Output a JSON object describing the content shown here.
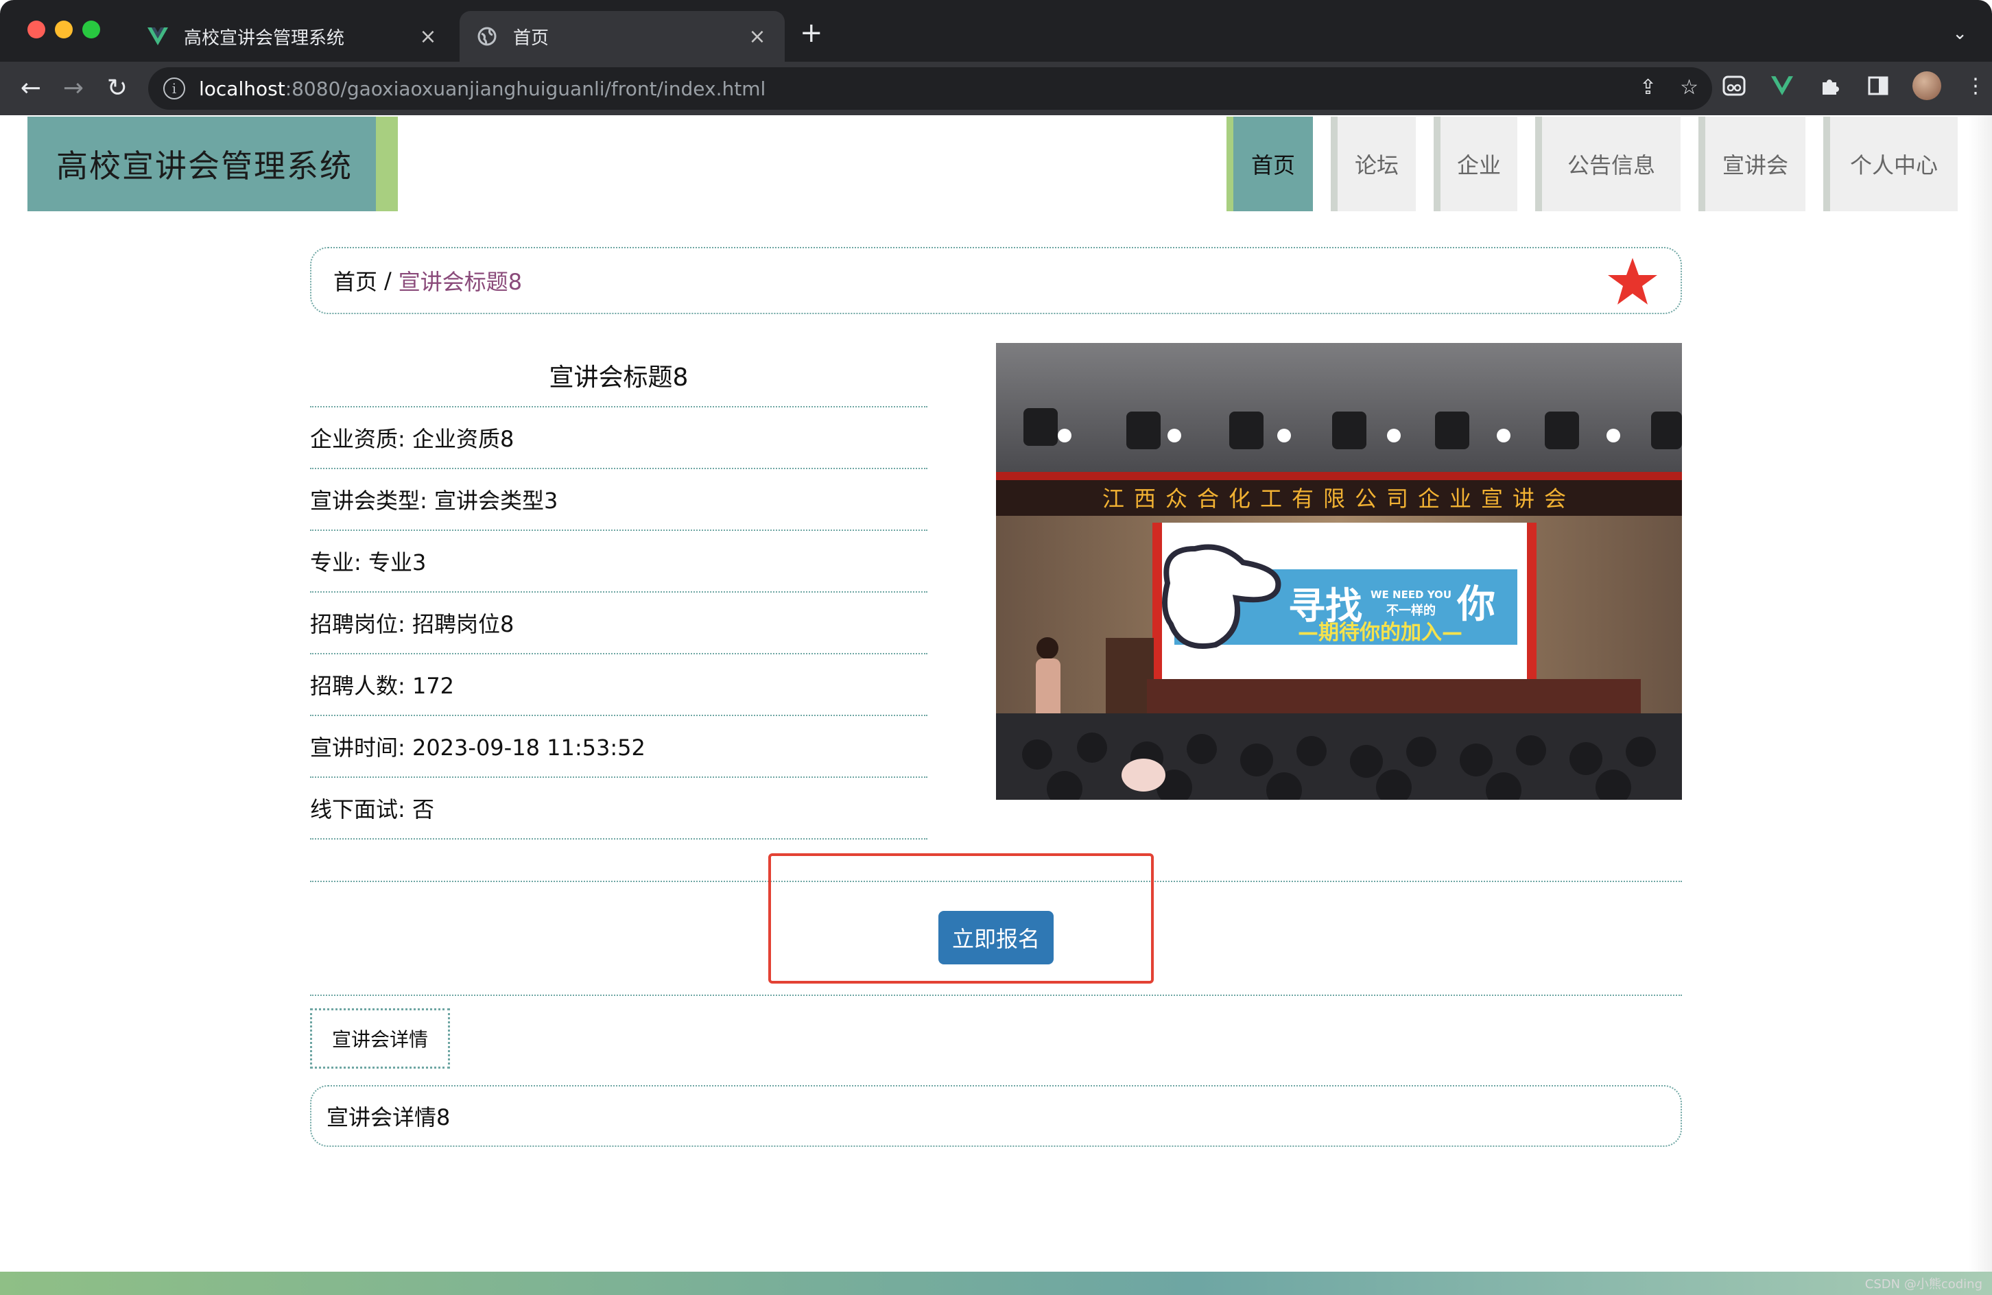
{
  "browser": {
    "tabs": [
      {
        "title": "高校宣讲会管理系统",
        "close": "×"
      },
      {
        "title": "首页",
        "close": "×"
      }
    ],
    "new_tab": "+",
    "address": {
      "host": "localhost",
      "path": ":8080/gaoxiaoxuanjianghuiguanli/front/index.html"
    }
  },
  "site": {
    "logo": "高校宣讲会管理系统"
  },
  "nav": {
    "items": [
      {
        "label": "首页",
        "active": true
      },
      {
        "label": "论坛",
        "active": false
      },
      {
        "label": "企业",
        "active": false
      },
      {
        "label": "公告信息",
        "active": false
      },
      {
        "label": "宣讲会",
        "active": false
      },
      {
        "label": "个人中心",
        "active": false
      }
    ]
  },
  "breadcrumb": {
    "home": "首页",
    "separator": "/",
    "current": "宣讲会标题8"
  },
  "detail": {
    "title": "宣讲会标题8",
    "fields": [
      {
        "label": "企业资质",
        "value": "企业资质8"
      },
      {
        "label": "宣讲会类型",
        "value": "宣讲会类型3"
      },
      {
        "label": "专业",
        "value": "专业3"
      },
      {
        "label": "招聘岗位",
        "value": "招聘岗位8"
      },
      {
        "label": "招聘人数",
        "value": "172"
      },
      {
        "label": "宣讲时间",
        "value": "2023-09-18 11:53:52"
      },
      {
        "label": "线下面试",
        "value": "否"
      }
    ],
    "rows": [
      "企业资质: 企业资质8",
      "宣讲会类型: 宣讲会类型3",
      "专业: 专业3",
      "招聘岗位: 招聘岗位8",
      "招聘人数: 172",
      "宣讲时间: 2023-09-18 11:53:52",
      "线下面试: 否"
    ]
  },
  "photo": {
    "banner": "江西众合化工有限公司企业宣讲会",
    "screen_main": "寻找",
    "screen_side_en": "WE NEED YOU",
    "screen_side_cn": "不一样的",
    "screen_you": "你",
    "screen_sub": "—期待你的加入—"
  },
  "signup_button": "立即报名",
  "detail_tab": "宣讲会详情",
  "detail_content": "宣讲会详情8",
  "watermark": "CSDN @小熊coding",
  "colors": {
    "theme": "#6ea6a3",
    "accent": "#a8cf80",
    "button": "#2f78b4",
    "highlight": "#e34234",
    "star": "#e8342c"
  },
  "icons": {
    "favorite": "star-icon"
  }
}
